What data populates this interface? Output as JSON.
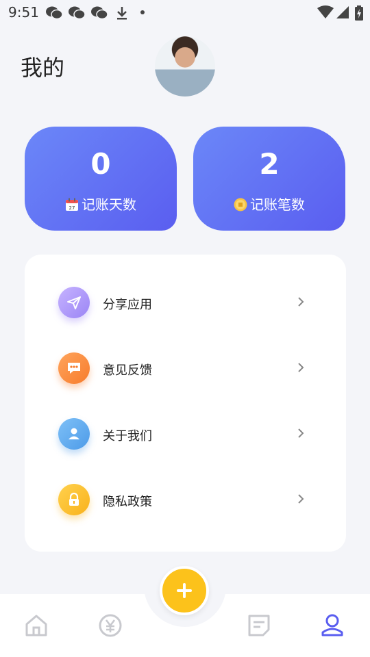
{
  "status_bar": {
    "time": "9:51"
  },
  "header": {
    "title": "我的"
  },
  "stats": [
    {
      "value": "0",
      "label": "记账天数",
      "icon": "calendar-icon",
      "calendar_day": "27"
    },
    {
      "value": "2",
      "label": "记账笔数",
      "icon": "coin-icon"
    }
  ],
  "menu": [
    {
      "label": "分享应用",
      "icon": "send-icon",
      "color": "#a78bfa"
    },
    {
      "label": "意见反馈",
      "icon": "chat-icon",
      "color": "#fb8c3c"
    },
    {
      "label": "关于我们",
      "icon": "user-icon",
      "color": "#5aa9f0"
    },
    {
      "label": "隐私政策",
      "icon": "lock-icon",
      "color": "#fbbc2c"
    }
  ],
  "bottom_nav": [
    {
      "icon": "home-icon",
      "active": false
    },
    {
      "icon": "yen-icon",
      "active": false
    },
    {
      "icon": "notes-icon",
      "active": false
    },
    {
      "icon": "profile-icon",
      "active": true
    }
  ],
  "colors": {
    "accent": "#5a5ef0",
    "fab": "#fcc21b",
    "inactive": "#c8c9ce"
  }
}
